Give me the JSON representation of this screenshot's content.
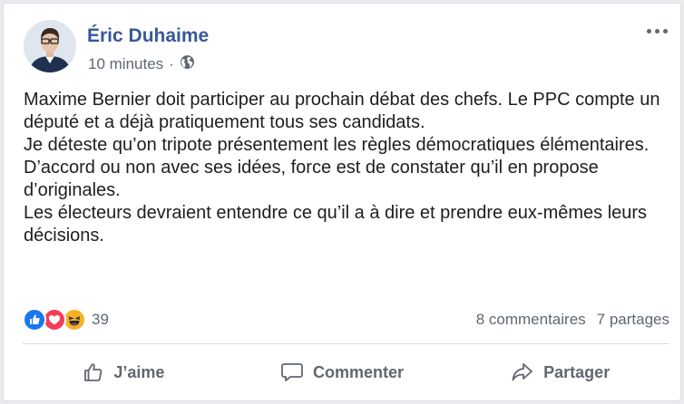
{
  "post": {
    "author": "Éric Duhaime",
    "timestamp": "10 minutes",
    "separator": "·",
    "privacy_icon": "globe-icon",
    "more_icon": "more-options-icon",
    "body": [
      "Maxime Bernier doit participer au prochain débat des chefs. Le PPC compte un député et a déjà pratiquement tous ses candidats.",
      "Je déteste qu’on tripote présentement les règles démocratiques élémentaires.",
      "D’accord ou non avec ses idées, force est de constater qu’il en propose d’originales.",
      "Les électeurs devraient entendre ce qu’il a à dire et prendre eux-mêmes leurs décisions."
    ]
  },
  "stats": {
    "reaction_icons": [
      "like-icon",
      "love-icon",
      "haha-icon"
    ],
    "reaction_count": "39",
    "comments": "8 commentaires",
    "shares": "7 partages"
  },
  "actions": {
    "like": "J’aime",
    "comment": "Commenter",
    "share": "Partager"
  },
  "colors": {
    "author": "#385898",
    "like": "#1877f2",
    "love": "#f33e58",
    "haha": "#f7b125",
    "secondary_text": "#606770"
  }
}
